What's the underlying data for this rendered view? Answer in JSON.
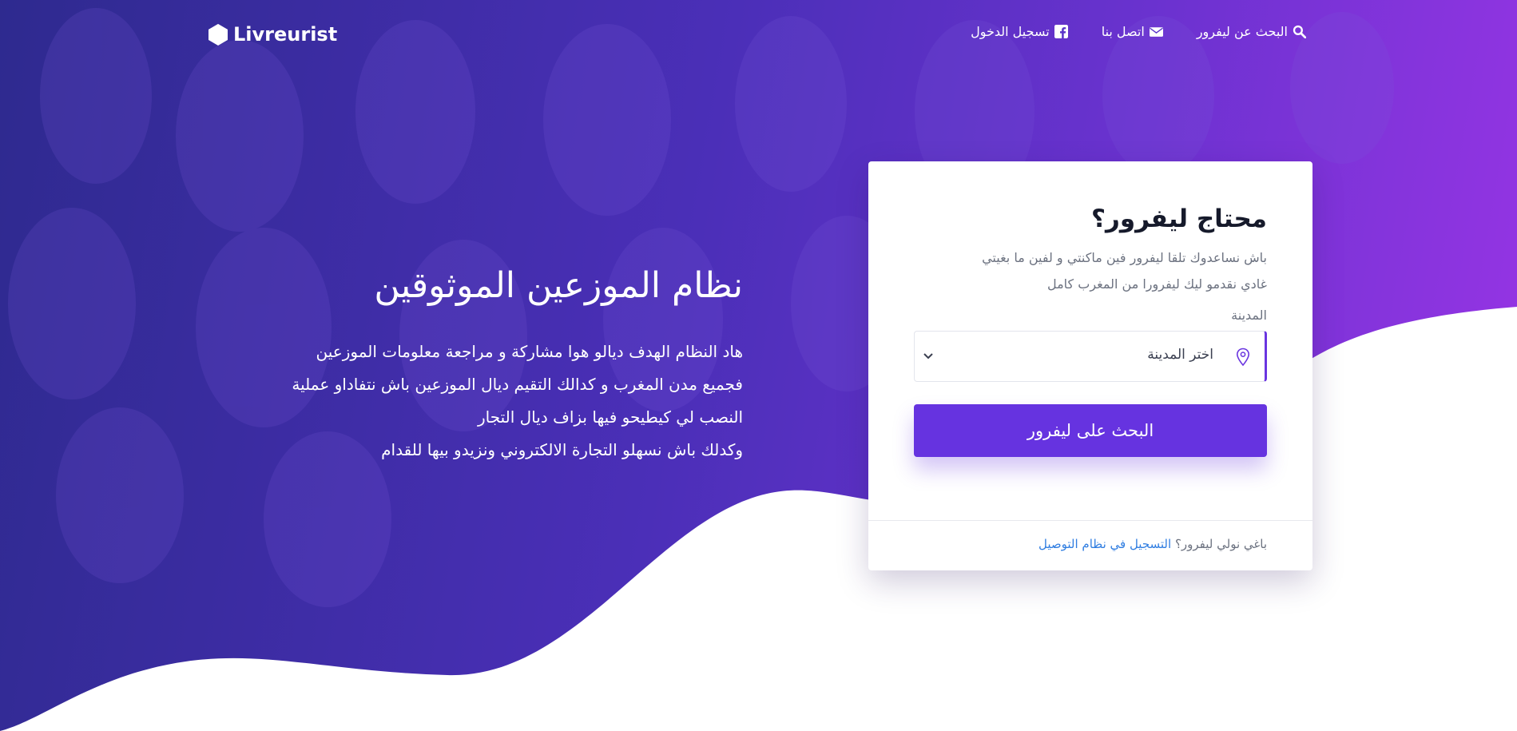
{
  "colors": {
    "hero_gradient_start": "#2e2a8f",
    "hero_gradient_end": "#9a35e6",
    "primary_button": "#6633e0",
    "link": "#2f7de1",
    "card_background": "#ffffff"
  },
  "navbar": {
    "brand": "Livreurist",
    "brand_icon": "box-icon",
    "links": [
      {
        "label": "تسجيل الدخول",
        "icon": "facebook-icon"
      },
      {
        "label": "اتصل بنا",
        "icon": "envelope-icon"
      },
      {
        "label": "البحث عن ليفرور",
        "icon": "search-icon"
      }
    ]
  },
  "hero": {
    "title": "نظام الموزعين الموثوقين",
    "description_lines": [
      "هاد النظام الهدف ديالو هوا مشاركة و مراجعة معلومات الموزعين",
      "فجميع مدن المغرب و كدالك التقيم ديال الموزعين باش نتفاداو عملية",
      "النصب لي كيطيحو فيها بزاف ديال التجار",
      "وكدلك باش نسهلو التجارة الالكتروني ونزيدو بيها للقدام"
    ]
  },
  "search_card": {
    "title": "محتاج ليفرور؟",
    "description_lines": [
      "باش نساعدوك تلقا ليفرور فين ماكنتي و لفين ما بغيتي",
      "غادي نقدمو ليك ليفرورا من المغرب كامل"
    ],
    "city_label": "المدينة",
    "city_select": {
      "selected": "اختر المدينة",
      "icon": "map-pin-icon"
    },
    "search_button": "البحث على ليفرور",
    "footer_text": "باغي نولي ليفرور؟",
    "footer_link": "التسجيل في نظام التوصيل"
  }
}
